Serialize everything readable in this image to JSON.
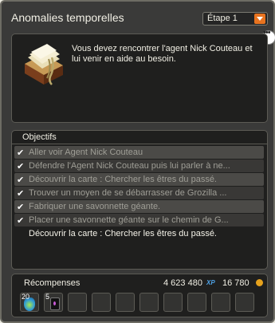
{
  "header": {
    "title": "Anomalies temporelles",
    "step_select": "Étape 1"
  },
  "description": {
    "text": "Vous devez rencontrer l'agent Nick Couteau et lui venir en aide au besoin."
  },
  "objectives": {
    "header": "Objectifs",
    "items": [
      {
        "text": "Aller voir Agent Nick Couteau",
        "completed": true
      },
      {
        "text": "Défendre l'Agent Nick Couteau puis lui parler à ne...",
        "completed": true
      },
      {
        "text": "Découvrir la carte : Chercher les êtres du passé.",
        "completed": true
      },
      {
        "text": "Trouver un moyen de se débarrasser de Grozilla ...",
        "completed": true
      },
      {
        "text": "Fabriquer une savonnette géante.",
        "completed": true
      },
      {
        "text": "Placer une savonnette géante sur le chemin de G...",
        "completed": true
      },
      {
        "text": "Découvrir la carte : Chercher les êtres du passé.",
        "completed": false
      }
    ]
  },
  "rewards": {
    "label": "Récompenses",
    "xp": "4 623 480",
    "xp_unit": "XP",
    "kamas": "16 780",
    "items": [
      {
        "quantity": "20",
        "icon": "potion-icon"
      },
      {
        "quantity": "5",
        "icon": "scroll-icon"
      }
    ],
    "empty_slots": 8
  },
  "colors": {
    "accent": "#e8731f",
    "window_bg": "#3a3a39",
    "panel_bg": "#1f1f1e"
  }
}
